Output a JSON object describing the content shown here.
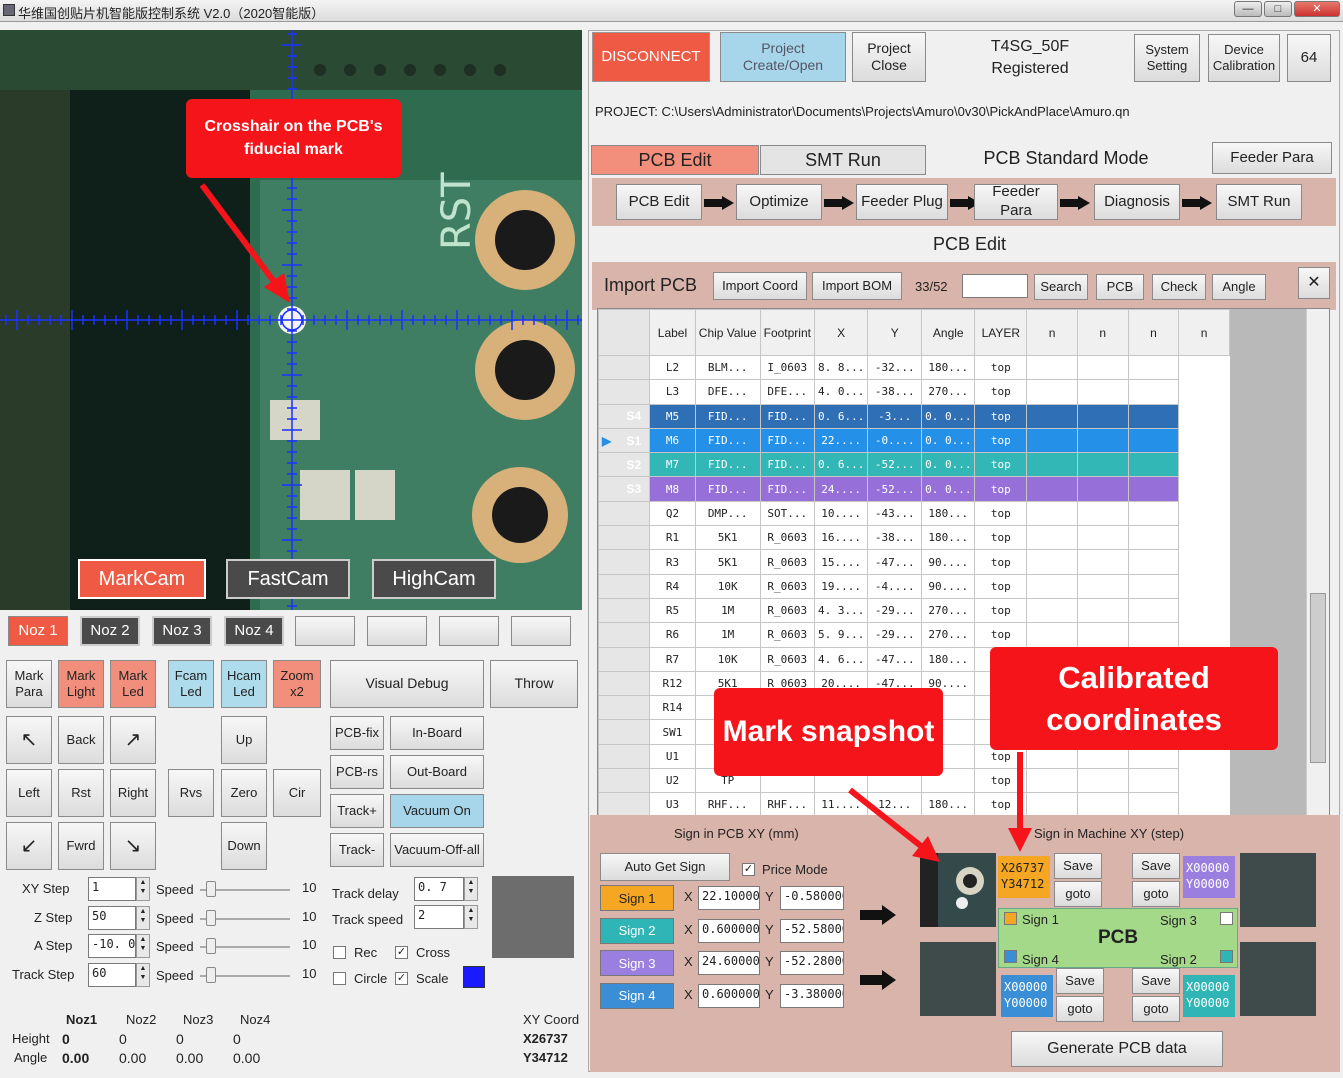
{
  "window": {
    "title": "华维国创贴片机智能版控制系统 V2.0（2020智能版）"
  },
  "camera": {
    "tabs": [
      "MarkCam",
      "FastCam",
      "HighCam"
    ],
    "pcb_text": "RST"
  },
  "callouts": {
    "crosshair": "Crosshair on the PCB's fiducial mark",
    "snapshot": "Mark snapshot",
    "calibrated": "Calibrated coordinates"
  },
  "nozzles": [
    "Noz 1",
    "Noz 2",
    "Noz 3",
    "Noz 4"
  ],
  "buttons": {
    "mark_para": "Mark Para",
    "mark_light": "Mark Light",
    "mark_led": "Mark Led",
    "fcam_led": "Fcam Led",
    "hcam_led": "Hcam Led",
    "zoom": "Zoom x2",
    "visual_debug": "Visual Debug",
    "throw": "Throw",
    "up_left": "↖",
    "back": "Back",
    "up_right": "↗",
    "up": "Up",
    "left": "Left",
    "rst": "Rst",
    "right": "Right",
    "rvs": "Rvs",
    "zero": "Zero",
    "cir": "Cir",
    "down_left": "↙",
    "fwrd": "Fwrd",
    "down_right": "↘",
    "down": "Down",
    "pcb_fix": "PCB-fix",
    "in_board": "In-Board",
    "pcb_rs": "PCB-rs",
    "out_board": "Out-Board",
    "track_plus": "Track+",
    "vacuum_on": "Vacuum On",
    "track_minus": "Track-",
    "vacuum_off": "Vacuum-Off-all"
  },
  "params": {
    "rows": [
      {
        "label": "XY Step",
        "value": "1"
      },
      {
        "label": "Z Step",
        "value": "50"
      },
      {
        "label": "A Step",
        "value": "-10. 0"
      },
      {
        "label": "Track Step",
        "value": "60"
      }
    ],
    "speed_label": "Speed",
    "speed_value": "10",
    "track_delay_label": "Track delay",
    "track_delay": "0. 7",
    "track_speed_label": "Track speed",
    "track_speed": "2",
    "rec": "Rec",
    "cross": "Cross",
    "circle": "Circle",
    "scale": "Scale"
  },
  "status": {
    "nozzles": [
      "Noz1",
      "Noz2",
      "Noz3",
      "Noz4"
    ],
    "height_label": "Height",
    "angle_label": "Angle",
    "heights": [
      "0",
      "0",
      "0",
      "0"
    ],
    "angles": [
      "0.00",
      "0.00",
      "0.00",
      "0.00"
    ],
    "xy_label": "XY Coord",
    "x": "X26737",
    "y": "Y34712"
  },
  "top": {
    "disconnect": "DISCONNECT",
    "project_create": "Project Create/Open",
    "project_close": "Project Close",
    "model": "T4SG_50F",
    "registered": "Registered",
    "system_setting": "System Setting",
    "device_calibration": "Device Calibration",
    "number": "64"
  },
  "project_path": "PROJECT: C:\\Users\\Administrator\\Documents\\Projects\\Amuro\\0v30\\PickAndPlace\\Amuro.qn",
  "tabs": {
    "pcb_edit": "PCB Edit",
    "smt_run": "SMT Run",
    "mode": "PCB Standard Mode",
    "feeder_para": "Feeder Para"
  },
  "flow": [
    "PCB Edit",
    "Optimize",
    "Feeder Plug",
    "Feeder Para",
    "Diagnosis",
    "SMT Run"
  ],
  "section_title": "PCB Edit",
  "import": {
    "title": "Import PCB",
    "import_coord": "Import Coord",
    "import_bom": "Import BOM",
    "count": "33/52",
    "search": "Search",
    "pcb": "PCB",
    "check": "Check",
    "angle": "Angle",
    "close": "✕"
  },
  "table": {
    "headers": [
      "Label",
      "Chip Value",
      "Footprint",
      "X",
      "Y",
      "Angle",
      "LAYER",
      "n",
      "n",
      "n",
      "n"
    ],
    "rows": [
      {
        "h": "",
        "c": [
          "L2",
          "BLM...",
          "I_0603",
          "8. 8...",
          "-32...",
          "180...",
          "top"
        ]
      },
      {
        "h": "",
        "c": [
          "L3",
          "DFE...",
          "DFE...",
          "4. 0...",
          "-38...",
          "270...",
          "top"
        ]
      },
      {
        "h": "S4",
        "c": [
          "M5",
          "FID...",
          "FID...",
          "0. 6...",
          "-3...",
          "0. 0...",
          "top"
        ]
      },
      {
        "h": "S1",
        "c": [
          "M6",
          "FID...",
          "FID...",
          "22....",
          "-0....",
          "0. 0...",
          "top"
        ]
      },
      {
        "h": "S2",
        "c": [
          "M7",
          "FID...",
          "FID...",
          "0. 6...",
          "-52...",
          "0. 0...",
          "top"
        ]
      },
      {
        "h": "S3",
        "c": [
          "M8",
          "FID...",
          "FID...",
          "24....",
          "-52...",
          "0. 0...",
          "top"
        ]
      },
      {
        "h": "",
        "c": [
          "Q2",
          "DMP...",
          "SOT...",
          "10....",
          "-43...",
          "180...",
          "top"
        ]
      },
      {
        "h": "",
        "c": [
          "R1",
          "5K1",
          "R_0603",
          "16....",
          "-38...",
          "180...",
          "top"
        ]
      },
      {
        "h": "",
        "c": [
          "R3",
          "5K1",
          "R_0603",
          "15....",
          "-47...",
          "90....",
          "top"
        ]
      },
      {
        "h": "",
        "c": [
          "R4",
          "10K",
          "R_0603",
          "19....",
          "-4....",
          "90....",
          "top"
        ]
      },
      {
        "h": "",
        "c": [
          "R5",
          "1M",
          "R_0603",
          "4. 3...",
          "-29...",
          "270...",
          "top"
        ]
      },
      {
        "h": "",
        "c": [
          "R6",
          "1M",
          "R_0603",
          "5. 9...",
          "-29...",
          "270...",
          "top"
        ]
      },
      {
        "h": "",
        "c": [
          "R7",
          "10K",
          "R_0603",
          "4. 6...",
          "-47...",
          "180...",
          "t"
        ]
      },
      {
        "h": "",
        "c": [
          "R12",
          "5K1",
          "R_0603",
          "20....",
          "-47...",
          "90....",
          "t"
        ]
      },
      {
        "h": "",
        "c": [
          "R14",
          "",
          "",
          "",
          "",
          "",
          "t"
        ]
      },
      {
        "h": "",
        "c": [
          "SW1",
          "",
          "",
          "",
          "",
          "",
          "t"
        ]
      },
      {
        "h": "",
        "c": [
          "U1",
          "A",
          "",
          "",
          "",
          "",
          "top"
        ]
      },
      {
        "h": "",
        "c": [
          "U2",
          "TP",
          "",
          "",
          "",
          "",
          "top"
        ]
      },
      {
        "h": "",
        "c": [
          "U3",
          "RHF...",
          "RHF...",
          "11....",
          "12...",
          "180...",
          "top"
        ]
      }
    ]
  },
  "sign": {
    "pcb_title": "Sign in PCB XY (mm)",
    "machine_title": "Sign in Machine XY (step)",
    "auto": "Auto Get Sign",
    "precise": "Price Mode",
    "signs": [
      {
        "name": "Sign 1",
        "x": "22.100000",
        "y": "-0.580000",
        "color": "#f5a623"
      },
      {
        "name": "Sign 2",
        "x": "0.600000",
        "y": "-52.580000",
        "color": "#2fb5b5"
      },
      {
        "name": "Sign 3",
        "x": "24.600000",
        "y": "-52.280000",
        "color": "#9b7fe0"
      },
      {
        "name": "Sign 4",
        "x": "0.600000",
        "y": "-3.380000",
        "color": "#3a8ed6"
      }
    ],
    "x_label": "X",
    "y_label": "Y",
    "coord1_x": "X26737",
    "coord1_y": "Y34712",
    "coord0_x": "X00000",
    "coord0_y": "Y00000",
    "save": "Save",
    "goto": "goto",
    "pcb": "PCB",
    "corner_labels": [
      "Sign 1",
      "Sign 3",
      "Sign 4",
      "Sign 2"
    ],
    "generate": "Generate PCB data"
  }
}
